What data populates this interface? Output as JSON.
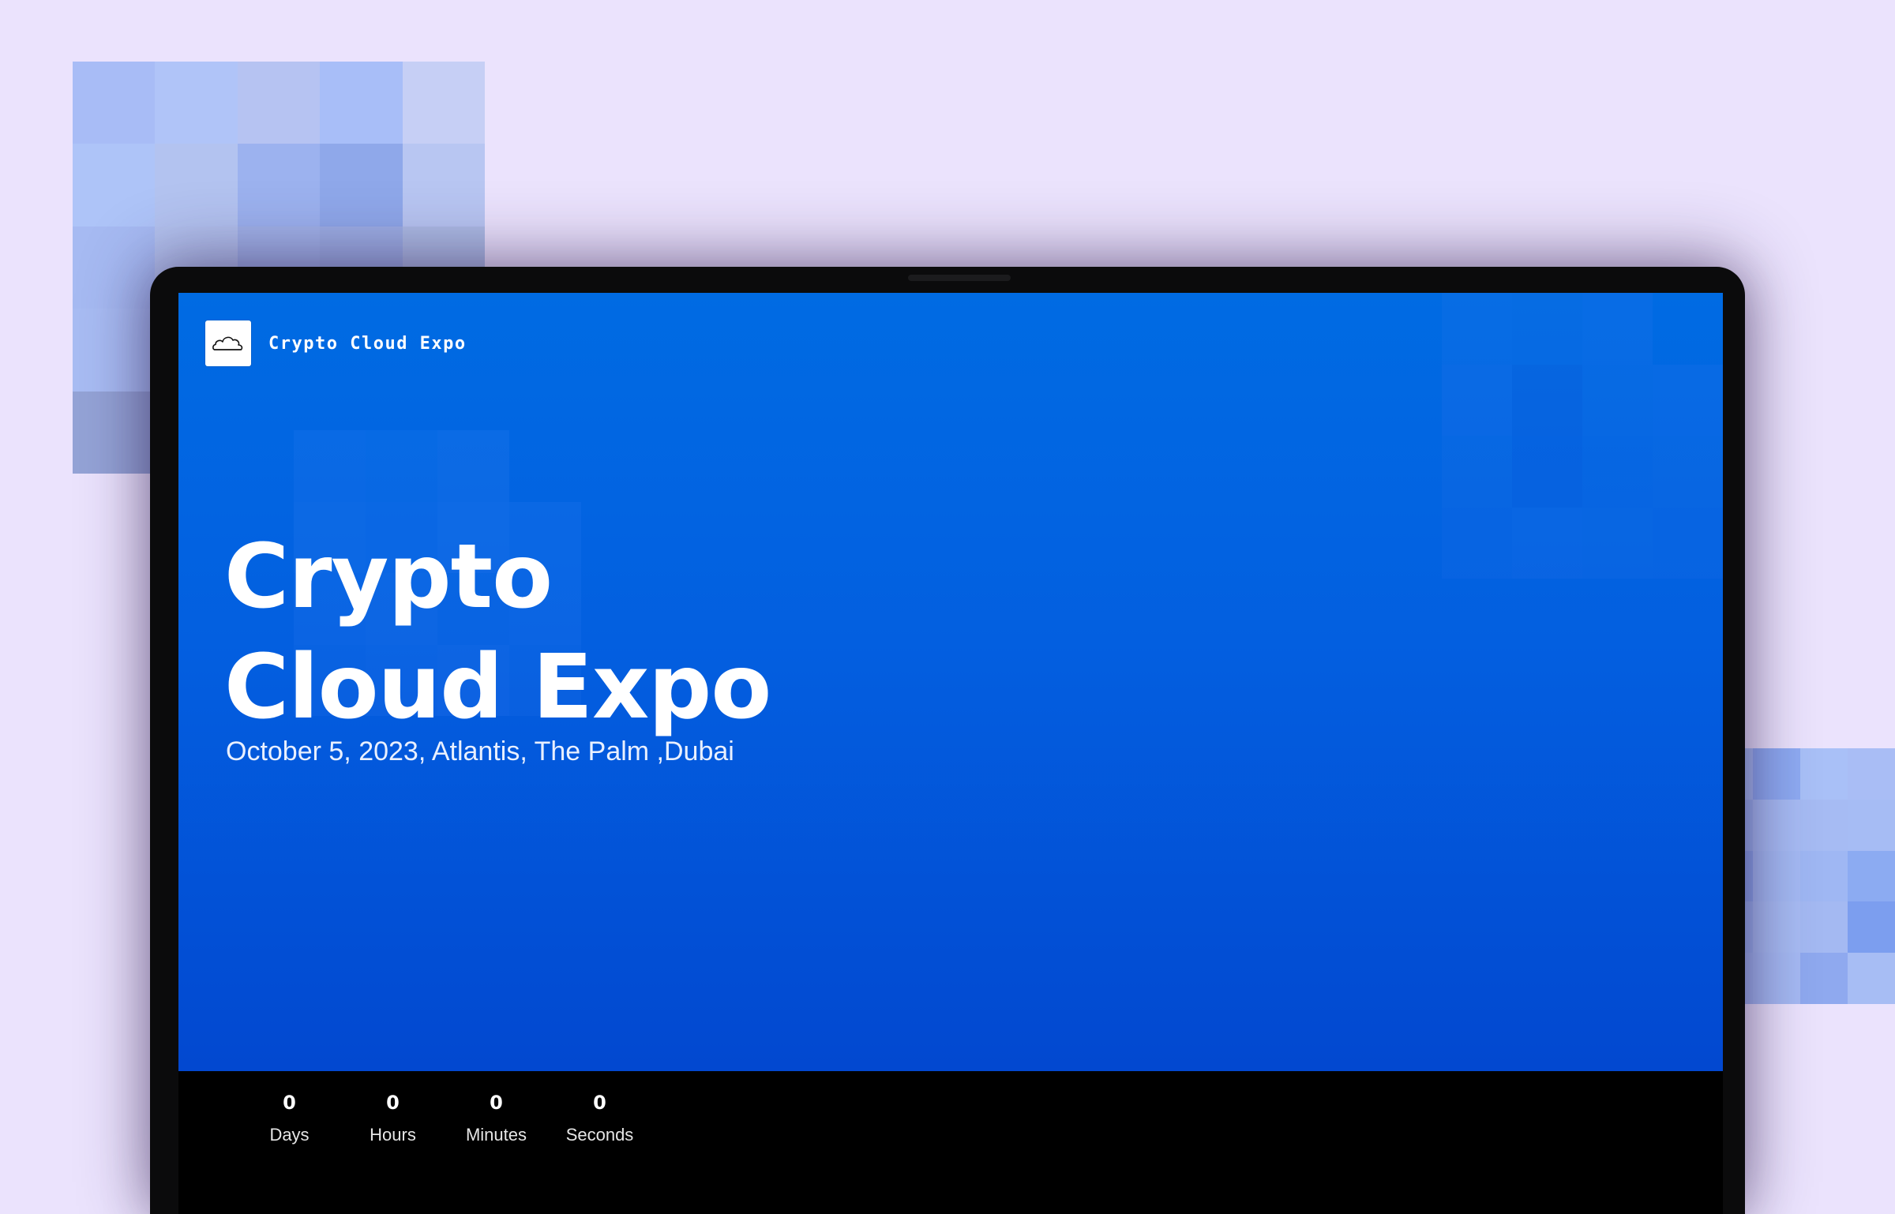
{
  "brand": {
    "name": "Crypto Cloud Expo",
    "logo_icon": "cloud-icon"
  },
  "hero": {
    "title_line1": "Crypto",
    "title_line2": "Cloud Expo",
    "subtitle": "October 5, 2023, Atlantis, The Palm ,Dubai"
  },
  "countdown": [
    {
      "value": "0",
      "label": "Days"
    },
    {
      "value": "0",
      "label": "Hours"
    },
    {
      "value": "0",
      "label": "Minutes"
    },
    {
      "value": "0",
      "label": "Seconds"
    }
  ],
  "colors": {
    "page_background": "#ebe3fd",
    "hero_gradient_top": "#006be3",
    "hero_gradient_bottom": "#0248d0",
    "laptop_frame": "#0b0b0c",
    "countdown_bar": "#000000"
  }
}
